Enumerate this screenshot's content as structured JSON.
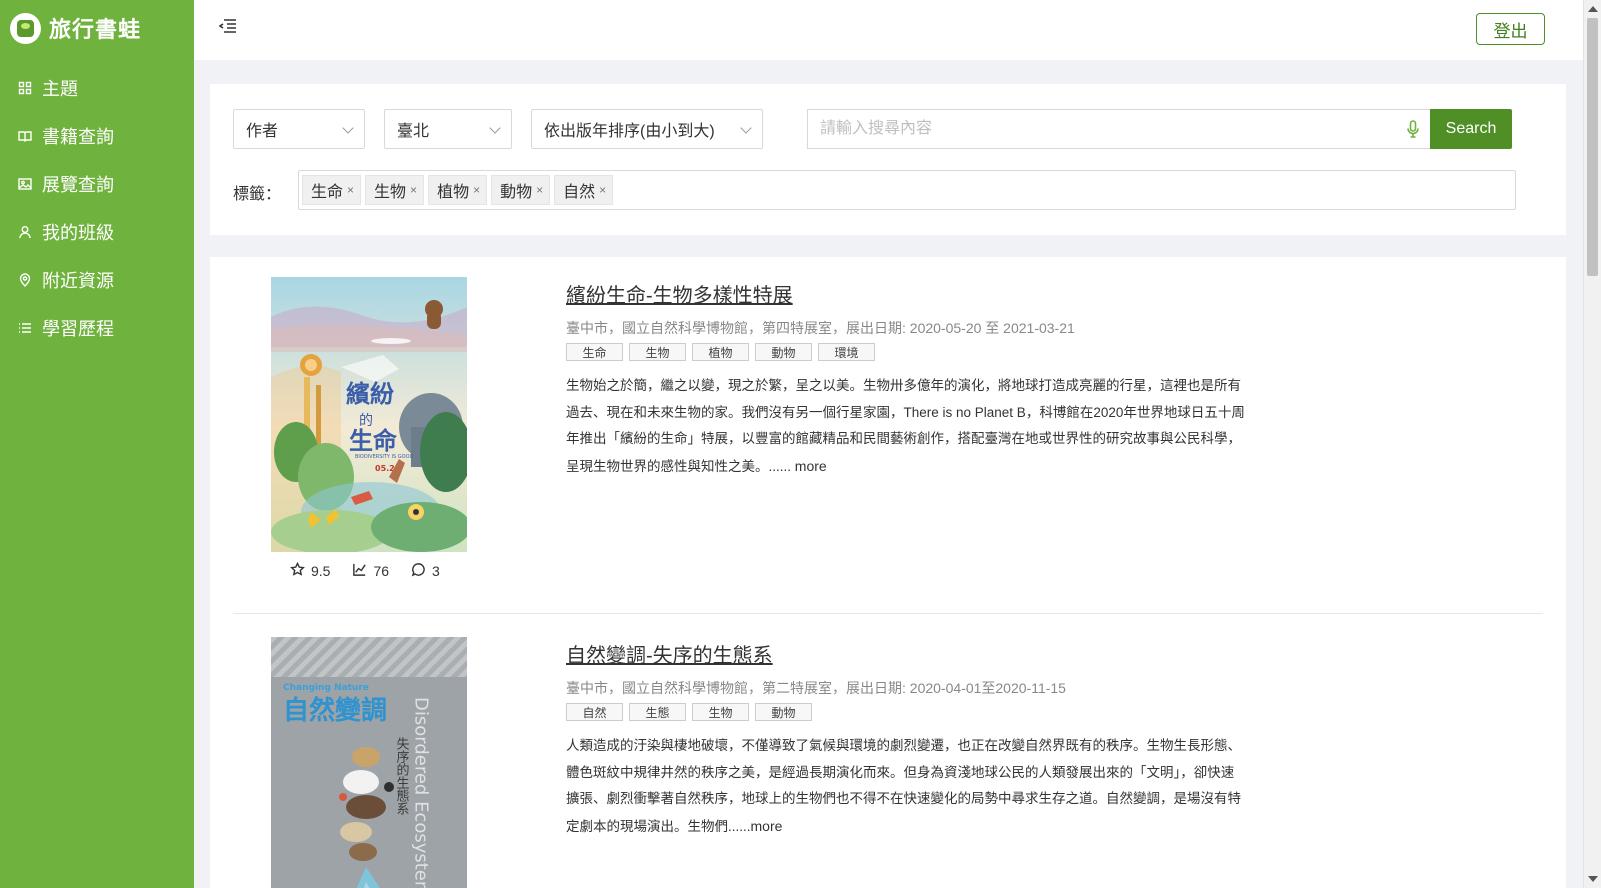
{
  "app": {
    "name": "旅行書蛙"
  },
  "sidebar": {
    "items": [
      {
        "label": "主題"
      },
      {
        "label": "書籍查詢"
      },
      {
        "label": "展覽查詢"
      },
      {
        "label": "我的班級"
      },
      {
        "label": "附近資源"
      },
      {
        "label": "學習歷程"
      }
    ]
  },
  "header": {
    "logout_label": "登出"
  },
  "search": {
    "field_select": "作者",
    "city_select": "臺北",
    "sort_select": "依出版年排序(由小到大)",
    "placeholder": "請輸入搜尋內容",
    "value": "",
    "button_label": "Search",
    "tags_label": "標籤：",
    "tags": [
      "生命",
      "生物",
      "植物",
      "動物",
      "自然"
    ]
  },
  "results": [
    {
      "title": "繽紛生命-生物多樣性特展",
      "meta": "臺中市，國立自然科學博物館，第四特展室，展出日期: 2020-05-20 至 2021-03-21",
      "tags": [
        "生命",
        "生物",
        "植物",
        "動物",
        "環境"
      ],
      "description": "生物始之於簡，繼之以變，現之於繁，呈之以美。生物卅多億年的演化，將地球打造成亮麗的行星，這裡也是所有過去、現在和未來生物的家。我們沒有另一個行星家園，There is no Planet B，科博館在2020年世界地球日五十周年推出「繽紛的生命」特展，以豐富的館藏精品和民間藝術創作，搭配臺灣在地或世界性的研究故事與公民科學，呈現生物世界的感性與知性之美。......",
      "more": "more",
      "rating": "9.5",
      "views": "76",
      "comments": "3",
      "poster": {
        "title_text": "繽紛的生命",
        "subtitle": "BIODIVERSITY IS GOOD",
        "date": "05.20"
      }
    },
    {
      "title": "自然變調-失序的生態系",
      "meta": "臺中市，國立自然科學博物館，第二特展室，展出日期: 2020-04-01至2020-11-15",
      "tags": [
        "自然",
        "生態",
        "生物",
        "動物"
      ],
      "description": "人類造成的汙染與棲地破壞，不僅導致了氣候與環境的劇烈變遷，也正在改變自然界既有的秩序。生物生長形態、體色斑紋中規律井然的秩序之美，是經過長期演化而來。但身為資淺地球公民的人類發展出來的「文明」，卻快速擴張、劇烈衝擊著自然秩序，地球上的生物們也不得不在快速變化的局勢中尋求生存之道。自然變調，是場沒有特定劇本的現場演出。生物們......",
      "more": "more",
      "poster": {
        "english": "Changing Nature",
        "title_text": "自然變調",
        "side_text": "失序的生態系",
        "side_english": "Disordered Ecosystems"
      }
    }
  ],
  "colors": {
    "sidebar": "#6fb23e",
    "accent": "#4f8f25",
    "background": "#f0f2f5"
  }
}
